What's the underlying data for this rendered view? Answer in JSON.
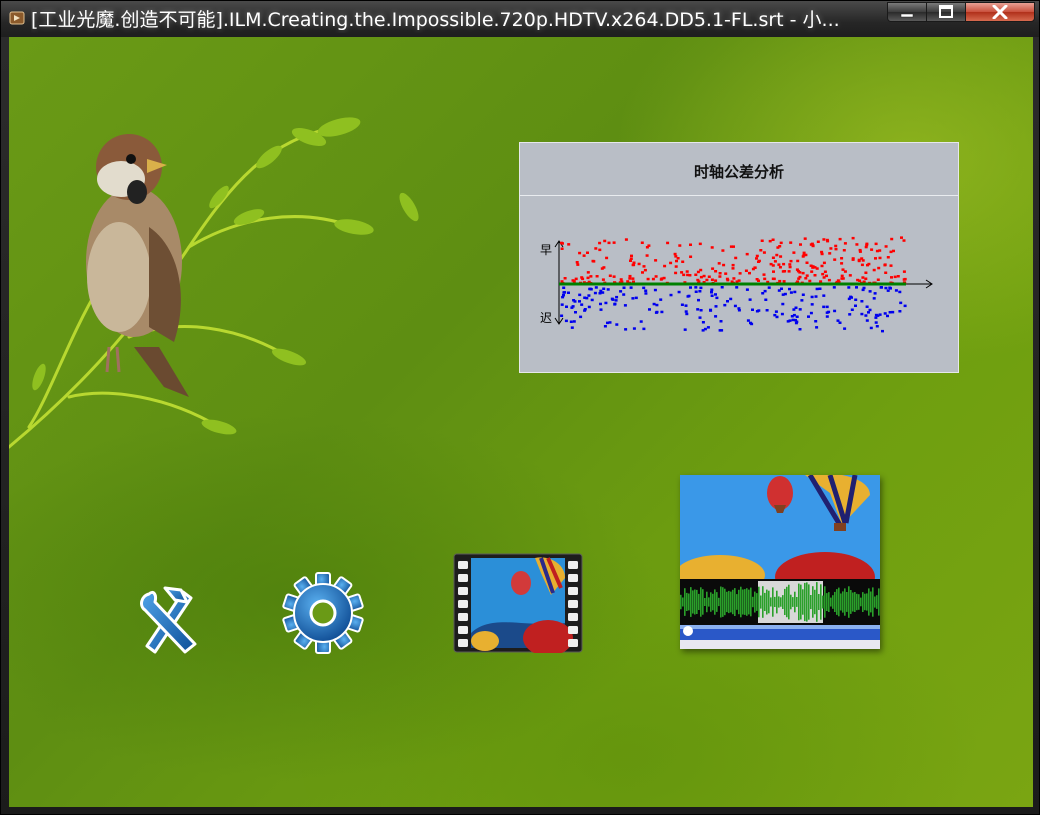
{
  "window": {
    "title": "[工业光魔.创造不可能].ILM.Creating.the.Impossible.720p.HDTV.x264.DD5.1-FL.srt - 小...",
    "controls": {
      "minimize": "—",
      "maximize": "☐",
      "close": "✕"
    }
  },
  "chart_panel": {
    "title": "时轴公差分析",
    "label_early": "早",
    "label_late": "迟"
  },
  "chart_data": {
    "type": "scatter",
    "title": "时轴公差分析",
    "ylabel_top": "早",
    "ylabel_bottom": "迟",
    "series": [
      {
        "color": "#ff0000"
      },
      {
        "color": "#0000ee"
      }
    ],
    "baseline_color": "#008000"
  },
  "toolbar": {
    "tools_icon": "tools-icon",
    "settings_icon": "gear-icon",
    "video_icon": "film-strip-icon",
    "waveform_thumb": "waveform-editor-thumbnail"
  },
  "colors": {
    "background": "#6a9a16",
    "panel": "#b9bec6",
    "icon_blue": "#1f6db8"
  }
}
